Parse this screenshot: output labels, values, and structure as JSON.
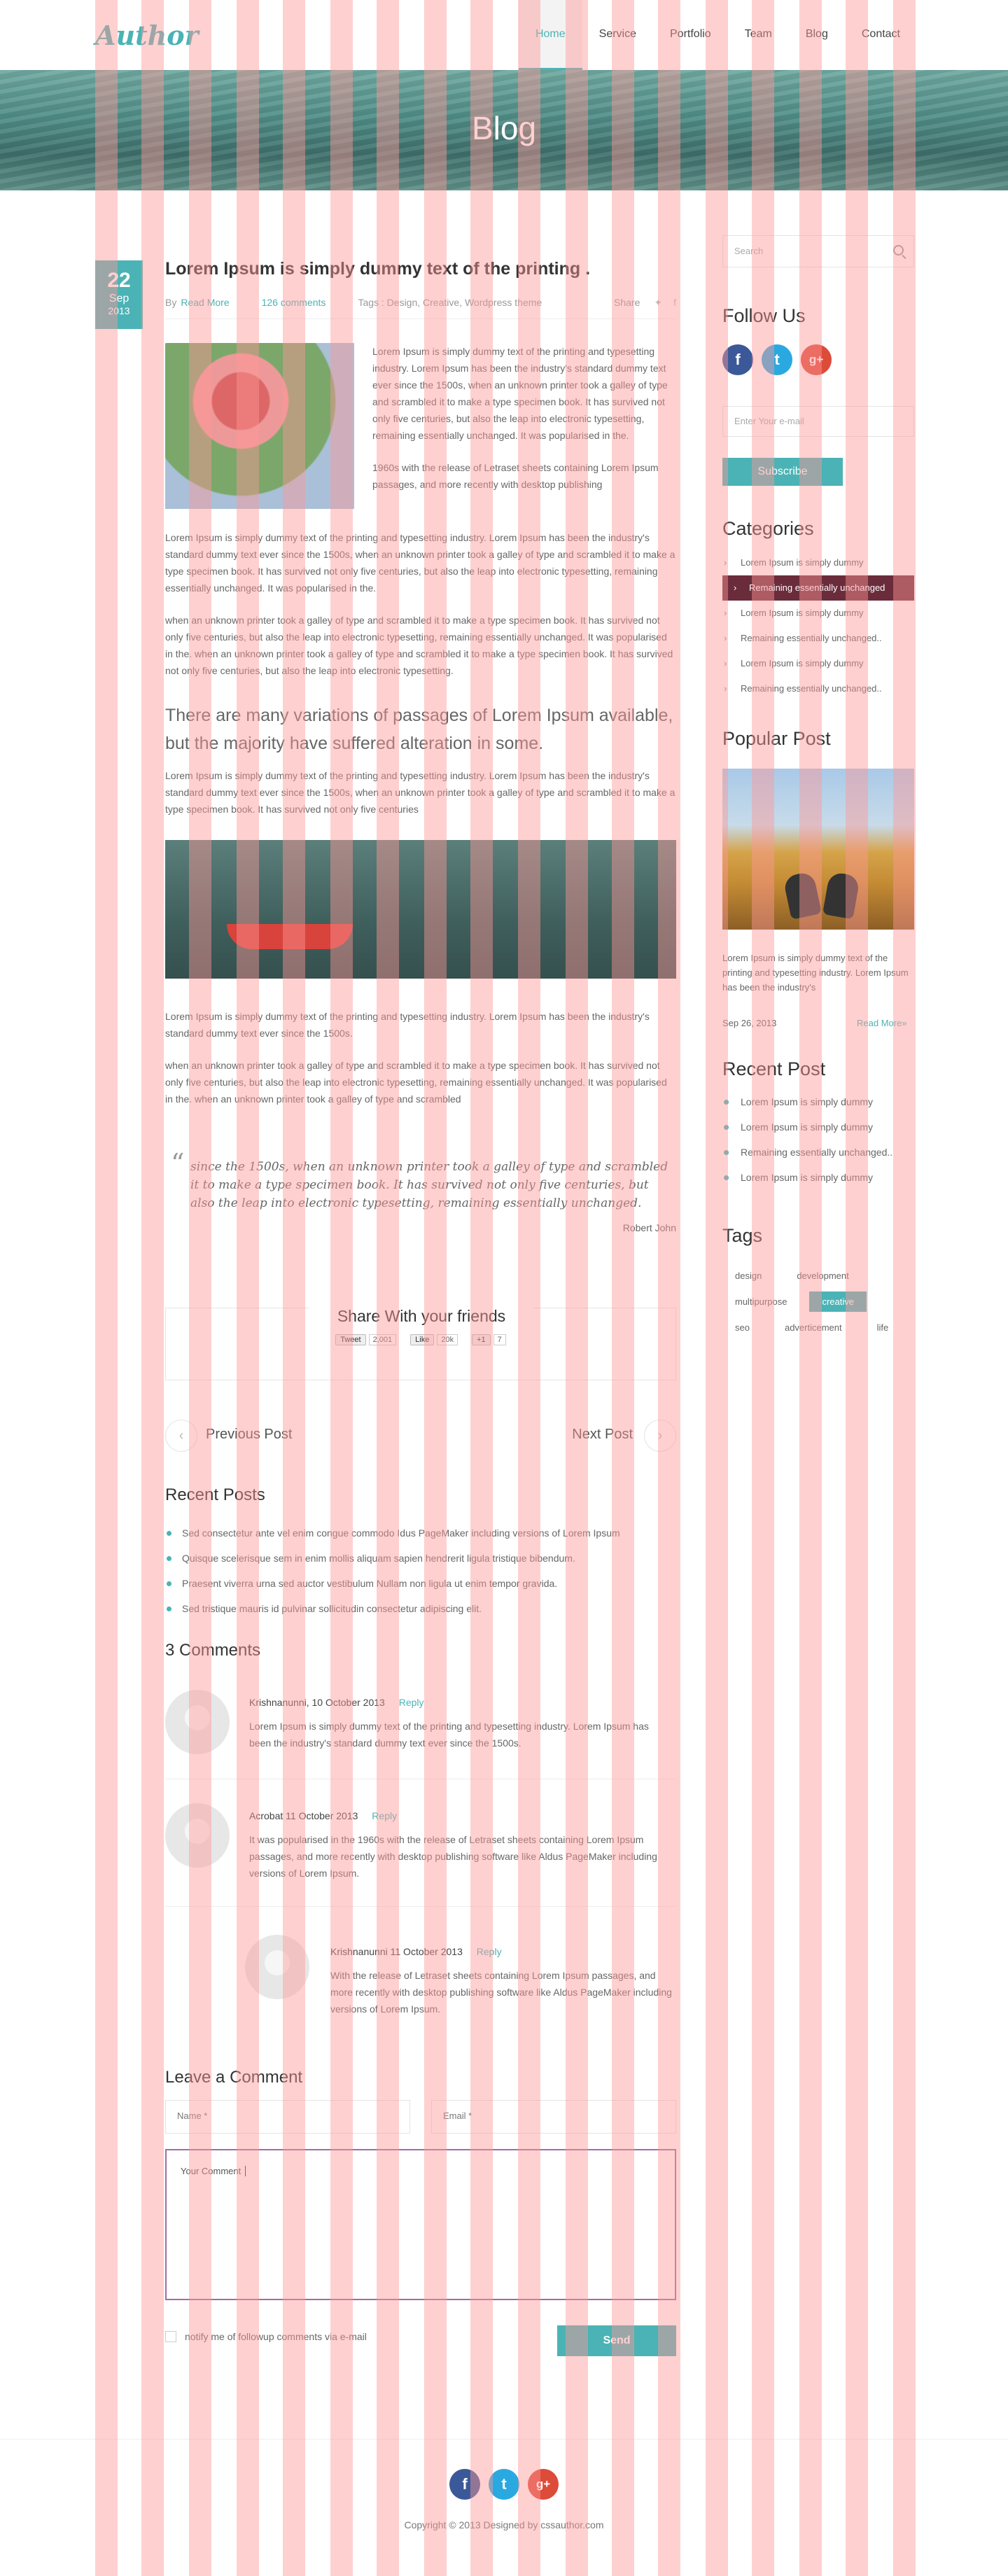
{
  "header": {
    "logo": "Author",
    "nav": [
      "Home",
      "Service",
      "Portfolio",
      "Team",
      "Blog",
      "Contact"
    ]
  },
  "hero": {
    "title": "Blog"
  },
  "post": {
    "day": "22",
    "month": "Sep",
    "year": "2013",
    "title": "Lorem Ipsum is simply dummy text of the printing .",
    "by": "By",
    "author": "Read More",
    "comments": "126 comments",
    "tags_label": "Tags : Design, Creative, Wordpress theme",
    "share": "Share",
    "intro1": "Lorem Ipsum is simply dummy text of the printing and typesetting industry. Lorem Ipsum has been the industry's standard dummy text ever since the 1500s, when an unknown printer took a galley of type and scrambled it to make a type specimen book. It has survived not only five centuries, but also the leap into electronic typesetting, remaining essentially unchanged. It was popularised in the.",
    "intro2": "1960s with the release of Letraset sheets containing Lorem Ipsum passages, and more recently with desktop publishing",
    "para1": "Lorem Ipsum is simply dummy text of the printing and typesetting industry. Lorem Ipsum has been the industry's standard dummy text ever since the 1500s, when an unknown printer took a galley of type and scrambled it to make a type specimen book. It has survived not only five centuries, but also the leap into electronic typesetting, remaining essentially unchanged. It was popularised in the.",
    "para2": "when an unknown printer took a galley of type and scrambled it to make a type specimen book. It has survived not only five centuries, but also the leap into electronic typesetting, remaining essentially unchanged. It was popularised in the. when an unknown printer took a galley of type and scrambled it to make a type specimen book. It has survived not only five centuries, but also the leap into electronic typesetting.",
    "lead": "There are many variations of passages of Lorem Ipsum available, but the majority have suffered alteration in some.",
    "para3": "Lorem Ipsum is simply dummy text of the printing and typesetting industry. Lorem Ipsum has been the industry's standard dummy text ever since the 1500s, when an unknown printer took a galley of type and scrambled it to make a type specimen book. It has survived not only five centuries",
    "para4": "Lorem Ipsum is simply dummy text of the printing and typesetting industry. Lorem Ipsum has been the industry's standard dummy text ever since the 1500s.",
    "para5": "when an unknown printer took a galley of type and scrambled it to make a type specimen book. It has survived not only five centuries, but also the leap into electronic typesetting, remaining essentially unchanged. It was popularised in the. when an unknown printer took a galley of type and scrambled",
    "quote": "since the 1500s, when an unknown printer took a galley of type and scrambled it to make a type specimen book. It has survived not only five centuries, but also the leap into electronic typesetting, remaining essentially unchanged.",
    "quote_author": "Robert John"
  },
  "share": {
    "title": "Share With your friends",
    "tweet": "Tweet",
    "tweet_count": "2,001",
    "like": "Like",
    "like_count": "20k",
    "gplus": "+1",
    "gplus_count": "7"
  },
  "nav_posts": {
    "prev": "Previous Post",
    "next": "Next Post"
  },
  "recent_posts": {
    "title": "Recent Posts",
    "items": [
      "Sed consectetur ante vel enim congue commodo Idus PageMaker including versions of Lorem Ipsum",
      "Quisque scelerisque sem in enim mollis aliquam sapien hendrerit ligula tristique bibendum.",
      "Praesent viverra urna sed auctor vestibulum Nullam non ligula ut enim tempor gravida.",
      "Sed tristique mauris id pulvinar sollicitudin consectetur adipiscing elit."
    ]
  },
  "comments": {
    "title": "3 Comments",
    "reply": "Reply",
    "items": [
      {
        "name": "Krishnanunni,",
        "date": "10 October 2013",
        "text": "Lorem Ipsum is simply dummy text of the printing and typesetting industry. Lorem Ipsum has been the industry's standard dummy text ever since the 1500s."
      },
      {
        "name": "Acrobat",
        "date": "11 October 2013",
        "text": "It was popularised in the 1960s with the release of Letraset sheets containing Lorem Ipsum passages, and more recently with desktop publishing software like Aldus PageMaker including versions of Lorem Ipsum."
      },
      {
        "name": "Krishnanunni",
        "date": "11 October 2013",
        "text": "With the release of Letraset sheets containing Lorem Ipsum passages, and more recently with desktop publishing software like Aldus PageMaker including versions of Lorem Ipsum."
      }
    ]
  },
  "form": {
    "title": "Leave a Comment",
    "name": "Name *",
    "email": "Email *",
    "comment": "Your Comment",
    "notify": "notify me of followup comments via e-mail",
    "send": "Send"
  },
  "sidebar": {
    "search": "Search",
    "follow": "Follow Us",
    "email_placeholder": "Enter Your e-mail",
    "subscribe": "Subscribe",
    "categories_title": "Categories",
    "categories": [
      "Lorem Ipsum is simply dummy",
      "Remaining essentially unchanged",
      "Lorem Ipsum is simply dummy",
      "Remaining essentially unchanged..",
      "Lorem Ipsum is simply dummy",
      "Remaining essentially unchanged.."
    ],
    "popular_title": "Popular Post",
    "popular_text": "Lorem Ipsum is simply dummy text of the printing and typesetting industry. Lorem Ipsum has been the industry's",
    "popular_date": "Sep 26, 2013",
    "popular_more": "Read More»",
    "recent_title": "Recent Post",
    "recent": [
      "Lorem Ipsum is simply dummy",
      "Lorem Ipsum is simply dummy",
      "Remaining essentially unchanged..",
      "Lorem Ipsum is simply dummy"
    ],
    "tags_title": "Tags",
    "tags": [
      "design",
      "development",
      "multipurpose",
      "creative",
      "seo",
      "adverticement",
      "life"
    ]
  },
  "social": {
    "facebook": "f",
    "twitter": "t",
    "google": "g+"
  },
  "footer": {
    "copyright": "Copyright © 2013 Designed by cssauthor.com"
  },
  "colors": {
    "accent": "#4bb3b5",
    "active_category": "#6a2c3b",
    "focus_border": "#a36aa8"
  }
}
